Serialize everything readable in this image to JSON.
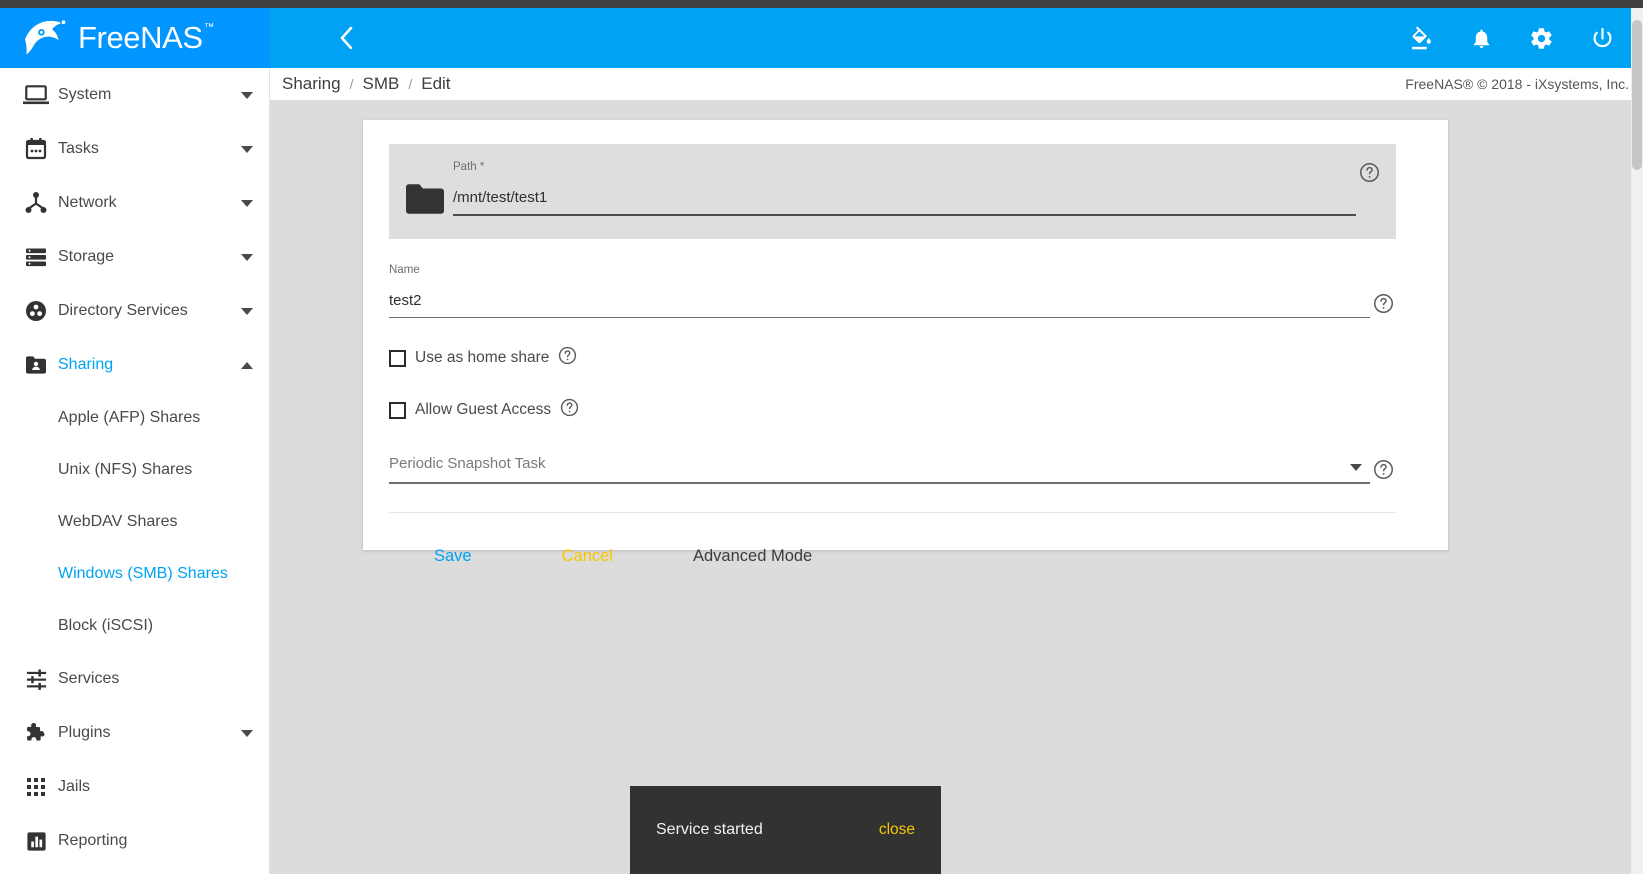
{
  "brand": {
    "name": "FreeNAS",
    "trademark": "™",
    "logo_icon": "freenas-fish-logo",
    "accent_color": "#00a2f3",
    "logo_bg": "#0095ff"
  },
  "toolbar": {
    "menu_icon": "hamburger-menu-icon",
    "back_icon": "chevron-left-icon",
    "actions": [
      {
        "icon": "theme-paint-bucket-icon",
        "name": "change-theme-button"
      },
      {
        "icon": "bell-notification-icon",
        "name": "notifications-button"
      },
      {
        "icon": "gear-settings-icon",
        "name": "settings-button"
      },
      {
        "icon": "power-icon",
        "name": "power-button"
      }
    ]
  },
  "breadcrumb": {
    "items": [
      "Sharing",
      "SMB",
      "Edit"
    ],
    "separator": "/"
  },
  "footer": {
    "copyright": "FreeNAS® © 2018 - iXsystems, Inc."
  },
  "sidebar": {
    "items": [
      {
        "label": "System",
        "icon": "laptop-icon",
        "expandable": true,
        "expanded": false,
        "active": false
      },
      {
        "label": "Tasks",
        "icon": "calendar-icon",
        "expandable": true,
        "expanded": false,
        "active": false
      },
      {
        "label": "Network",
        "icon": "network-hub-icon",
        "expandable": true,
        "expanded": false,
        "active": false
      },
      {
        "label": "Storage",
        "icon": "server-stack-icon",
        "expandable": true,
        "expanded": false,
        "active": false
      },
      {
        "label": "Directory Services",
        "icon": "directory-services-icon",
        "expandable": true,
        "expanded": false,
        "active": false
      },
      {
        "label": "Sharing",
        "icon": "folder-shared-icon",
        "expandable": true,
        "expanded": true,
        "active": true
      }
    ],
    "sharing_submenu": [
      {
        "label": "Apple (AFP) Shares",
        "active": false
      },
      {
        "label": "Unix (NFS) Shares",
        "active": false
      },
      {
        "label": "WebDAV Shares",
        "active": false
      },
      {
        "label": "Windows (SMB) Shares",
        "active": true
      },
      {
        "label": "Block (iSCSI)",
        "active": false
      }
    ],
    "items_after": [
      {
        "label": "Services",
        "icon": "sliders-icon",
        "expandable": false,
        "active": false
      },
      {
        "label": "Plugins",
        "icon": "puzzle-piece-icon",
        "expandable": true,
        "active": false
      },
      {
        "label": "Jails",
        "icon": "grid-dots-icon",
        "expandable": false,
        "active": false
      },
      {
        "label": "Reporting",
        "icon": "bar-chart-icon",
        "expandable": false,
        "active": false
      }
    ]
  },
  "form": {
    "path": {
      "label": "Path *",
      "value": "/mnt/test/test1",
      "placeholder": "",
      "folder_icon": "folder-icon",
      "help_icon": "help-circle-icon"
    },
    "name": {
      "label": "Name",
      "value": "test2",
      "placeholder": "",
      "help_icon": "help-circle-icon"
    },
    "checkboxes": [
      {
        "label": "Use as home share",
        "checked": false,
        "help_icon": "help-circle-icon"
      },
      {
        "label": "Allow Guest Access",
        "checked": false,
        "help_icon": "help-circle-icon"
      }
    ],
    "periodic_snapshot": {
      "label": "Periodic Snapshot Task",
      "value": "",
      "help_icon": "help-circle-icon",
      "caret_icon": "chevron-down-icon"
    },
    "buttons": {
      "save": "Save",
      "cancel": "Cancel",
      "advanced": "Advanced Mode",
      "save_color": "#00a2f3",
      "cancel_color": "#f7c600",
      "advanced_color": "#3c3c3c"
    }
  },
  "snackbar": {
    "message": "Service started",
    "action": "close",
    "action_color": "#f7c600",
    "bg": "#323232"
  }
}
